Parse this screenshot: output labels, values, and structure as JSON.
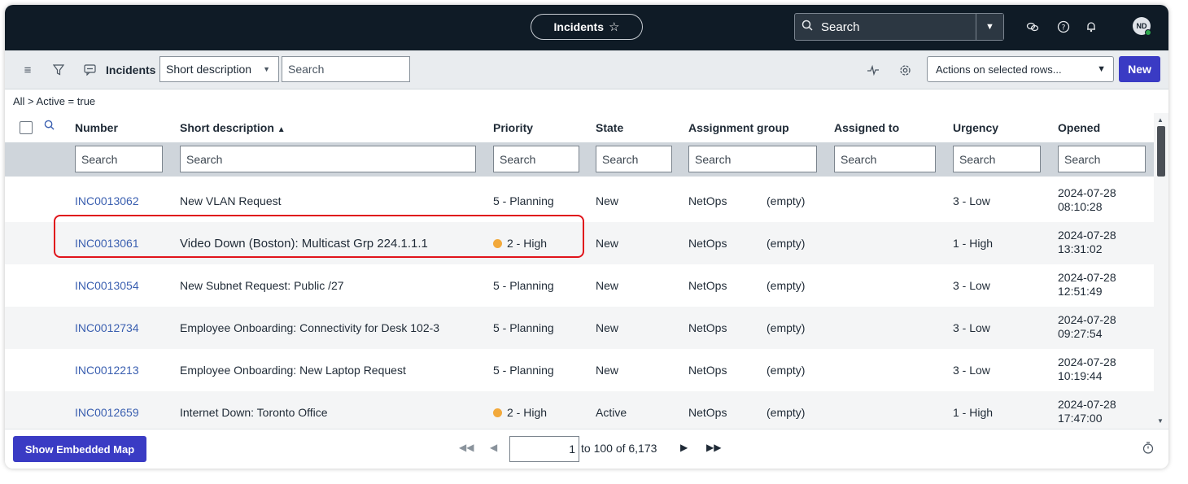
{
  "topbar": {
    "title": "Incidents",
    "star_icon": "☆",
    "search_placeholder": "Search",
    "avatar_initials": "ND"
  },
  "toolbar": {
    "list_label": "Incidents",
    "field_select": "Short description",
    "search_placeholder": "Search",
    "actions_label": "Actions on selected rows...",
    "new_label": "New"
  },
  "breadcrumb": "All > Active = true",
  "columns": [
    "Number",
    "Short description",
    "Priority",
    "State",
    "Assignment group",
    "Assigned to",
    "Urgency",
    "Opened"
  ],
  "filter_placeholder": "Search",
  "rows": [
    {
      "number": "INC0013062",
      "desc": "New VLAN Request",
      "priority": "5 - Planning",
      "priority_dot": false,
      "state": "New",
      "group": "NetOps",
      "assigned": "(empty)",
      "urgency": "3 - Low",
      "opened_date": "2024-07-28",
      "opened_time": "08:10:28"
    },
    {
      "number": "INC0013061",
      "desc": "Video Down (Boston): Multicast Grp 224.1.1.1",
      "priority": "2 - High",
      "priority_dot": true,
      "state": "New",
      "group": "NetOps",
      "assigned": "(empty)",
      "urgency": "1 - High",
      "opened_date": "2024-07-28",
      "opened_time": "13:31:02"
    },
    {
      "number": "INC0013054",
      "desc": "New Subnet Request: Public /27",
      "priority": "5 - Planning",
      "priority_dot": false,
      "state": "New",
      "group": "NetOps",
      "assigned": "(empty)",
      "urgency": "3 - Low",
      "opened_date": "2024-07-28",
      "opened_time": "12:51:49"
    },
    {
      "number": "INC0012734",
      "desc": "Employee Onboarding: Connectivity for Desk 102-3",
      "priority": "5 - Planning",
      "priority_dot": false,
      "state": "New",
      "group": "NetOps",
      "assigned": "(empty)",
      "urgency": "3 - Low",
      "opened_date": "2024-07-28",
      "opened_time": "09:27:54"
    },
    {
      "number": "INC0012213",
      "desc": "Employee Onboarding: New Laptop Request",
      "priority": "5 - Planning",
      "priority_dot": false,
      "state": "New",
      "group": "NetOps",
      "assigned": "(empty)",
      "urgency": "3 - Low",
      "opened_date": "2024-07-28",
      "opened_time": "10:19:44"
    },
    {
      "number": "INC0012659",
      "desc": "Internet Down: Toronto Office",
      "priority": "2 - High",
      "priority_dot": true,
      "state": "Active",
      "group": "NetOps",
      "assigned": "(empty)",
      "urgency": "1 - High",
      "opened_date": "2024-07-28",
      "opened_time": "17:47:00"
    }
  ],
  "footer": {
    "embed_label": "Show Embedded Map",
    "page_value": "1",
    "page_text": "to 100 of 6,173"
  },
  "colors": {
    "nav_bg": "#0f1b26",
    "accent": "#3a3bc4",
    "link": "#3a5fb0",
    "high_dot": "#f2a93b",
    "highlight_border": "#e0141b"
  }
}
